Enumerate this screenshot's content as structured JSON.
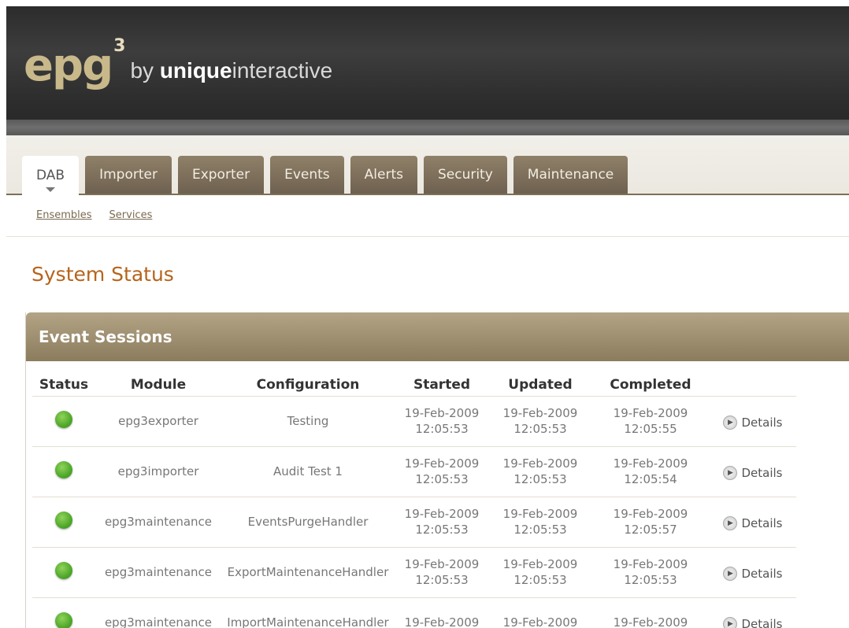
{
  "brand": {
    "logo_main": "epg",
    "logo_sup": "3",
    "logo_by": "by ",
    "logo_company_bold": "unique",
    "logo_company_rest": "interactive"
  },
  "tabs": [
    {
      "label": "DAB",
      "active": true
    },
    {
      "label": "Importer"
    },
    {
      "label": "Exporter"
    },
    {
      "label": "Events"
    },
    {
      "label": "Alerts"
    },
    {
      "label": "Security"
    },
    {
      "label": "Maintenance"
    }
  ],
  "subnav": [
    "Ensembles",
    "Services"
  ],
  "page_title": "System Status",
  "panel": {
    "title": "Event Sessions",
    "columns": [
      "Status",
      "Module",
      "Configuration",
      "Started",
      "Updated",
      "Completed"
    ],
    "details_label": "Details",
    "rows": [
      {
        "module": "epg3exporter",
        "configuration": "Testing",
        "started": [
          "19-Feb-2009",
          "12:05:53"
        ],
        "updated": [
          "19-Feb-2009",
          "12:05:53"
        ],
        "completed": [
          "19-Feb-2009",
          "12:05:55"
        ]
      },
      {
        "module": "epg3importer",
        "configuration": "Audit Test 1",
        "started": [
          "19-Feb-2009",
          "12:05:53"
        ],
        "updated": [
          "19-Feb-2009",
          "12:05:53"
        ],
        "completed": [
          "19-Feb-2009",
          "12:05:54"
        ]
      },
      {
        "module": "epg3maintenance",
        "configuration": "EventsPurgeHandler",
        "started": [
          "19-Feb-2009",
          "12:05:53"
        ],
        "updated": [
          "19-Feb-2009",
          "12:05:53"
        ],
        "completed": [
          "19-Feb-2009",
          "12:05:57"
        ]
      },
      {
        "module": "epg3maintenance",
        "configuration": "ExportMaintenanceHandler",
        "started": [
          "19-Feb-2009",
          "12:05:53"
        ],
        "updated": [
          "19-Feb-2009",
          "12:05:53"
        ],
        "completed": [
          "19-Feb-2009",
          "12:05:53"
        ]
      },
      {
        "module": "epg3maintenance",
        "configuration": "ImportMaintenanceHandler",
        "started": [
          "19-Feb-2009",
          ""
        ],
        "updated": [
          "19-Feb-2009",
          ""
        ],
        "completed": [
          "19-Feb-2009",
          ""
        ]
      }
    ]
  }
}
